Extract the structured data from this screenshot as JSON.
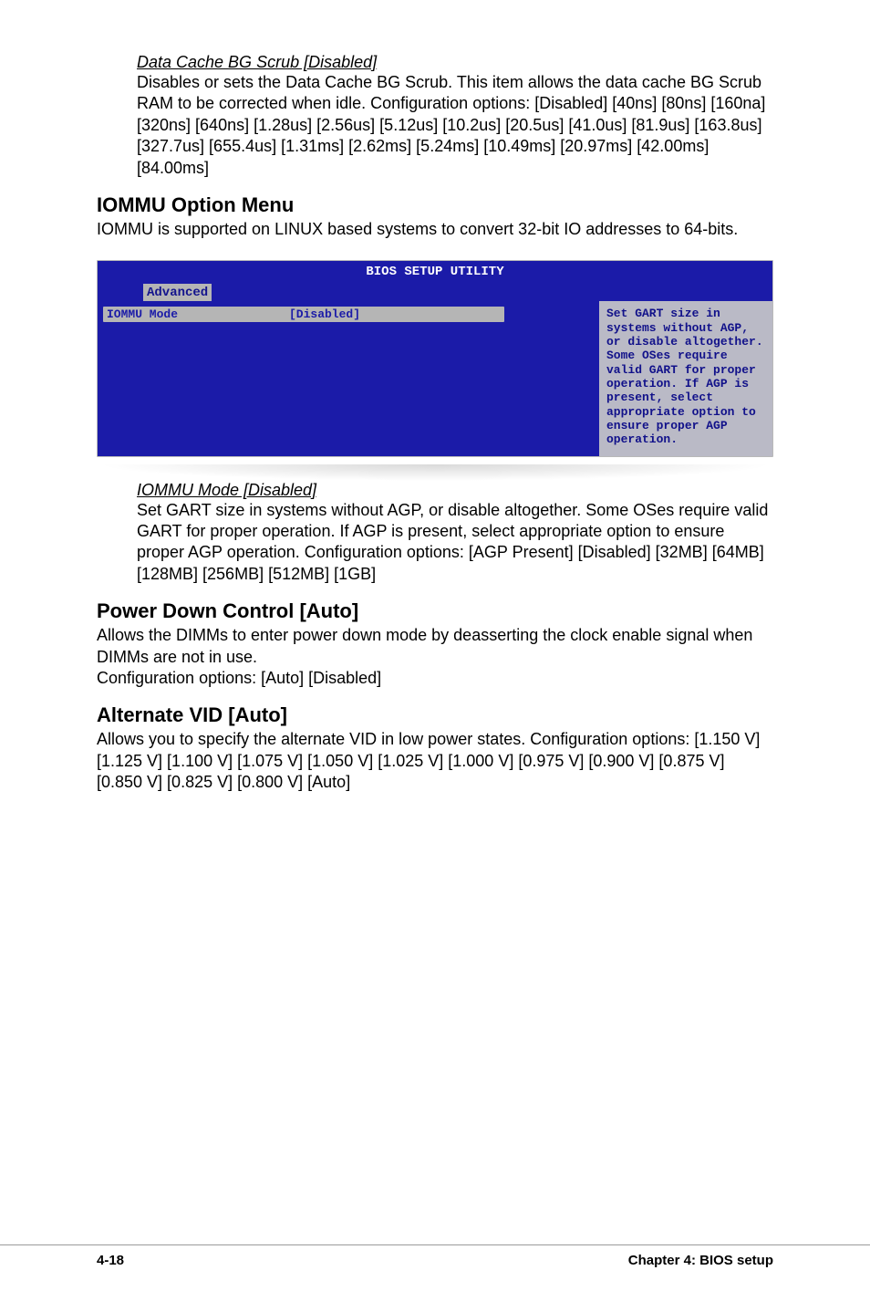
{
  "section1": {
    "title": "Data Cache BG Scrub [Disabled]",
    "body": "Disables or sets the Data Cache BG Scrub. This item allows the data cache BG Scrub RAM to be corrected when idle. Configuration options: [Disabled] [40ns] [80ns] [160na] [320ns] [640ns] [1.28us] [2.56us] [5.12us] [10.2us] [20.5us] [41.0us] [81.9us] [163.8us] [327.7us] [655.4us] [1.31ms] [2.62ms] [5.24ms] [10.49ms] [20.97ms] [42.00ms] [84.00ms]"
  },
  "heading1": "IOMMU Option Menu",
  "heading1_body": "IOMMU is supported on LINUX based systems to convert 32-bit IO addresses to 64-bits.",
  "bios": {
    "title": "BIOS SETUP UTILITY",
    "tab": "Advanced",
    "row_label": "IOMMU Mode",
    "row_value": "[Disabled]",
    "help": "Set GART size in systems without AGP, or disable altogether. Some OSes require valid GART for proper operation. If AGP is present, select appropriate option to ensure proper AGP operation."
  },
  "section2": {
    "title": "IOMMU Mode [Disabled]",
    "body": "Set GART size in systems without AGP, or disable altogether. Some OSes require valid GART for proper operation. If AGP is present, select appropriate option to ensure proper AGP operation. Configuration options: [AGP Present] [Disabled] [32MB] [64MB] [128MB] [256MB] [512MB] [1GB]"
  },
  "heading2": "Power Down Control [Auto]",
  "heading2_body": "Allows the DIMMs to enter power down mode by deasserting the clock enable signal when DIMMs are not in use.\nConfiguration options: [Auto] [Disabled]",
  "heading3": "Alternate VID [Auto]",
  "heading3_body": "Allows you to specify the alternate VID in low power states. Configuration options: [1.150 V] [1.125 V] [1.100 V] [1.075 V] [1.050 V] [1.025 V] [1.000 V] [0.975 V] [0.900 V] [0.875 V] [0.850 V] [0.825 V] [0.800 V] [Auto]",
  "footer_left": "4-18",
  "footer_right": "Chapter 4: BIOS setup"
}
